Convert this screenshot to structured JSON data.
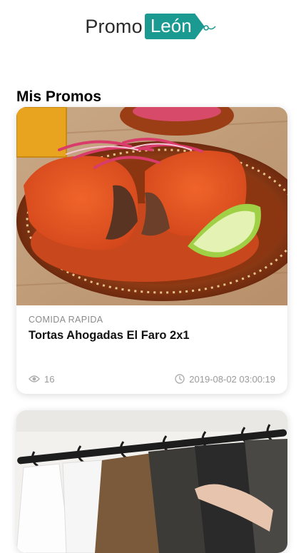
{
  "header": {
    "logo": {
      "text_left": "Promo",
      "text_tag": "León"
    }
  },
  "section": {
    "title": "Mis Promos"
  },
  "promos": [
    {
      "category": "COMIDA RAPIDA",
      "title": "Tortas Ahogadas El Faro 2x1",
      "views": "16",
      "datetime": "2019-08-02 03:00:19",
      "image": "tortas-ahogadas-photo"
    },
    {
      "image": "clothing-rack-photo"
    }
  ],
  "colors": {
    "brand": "#1b9a91",
    "meta": "#9a9a9a"
  }
}
